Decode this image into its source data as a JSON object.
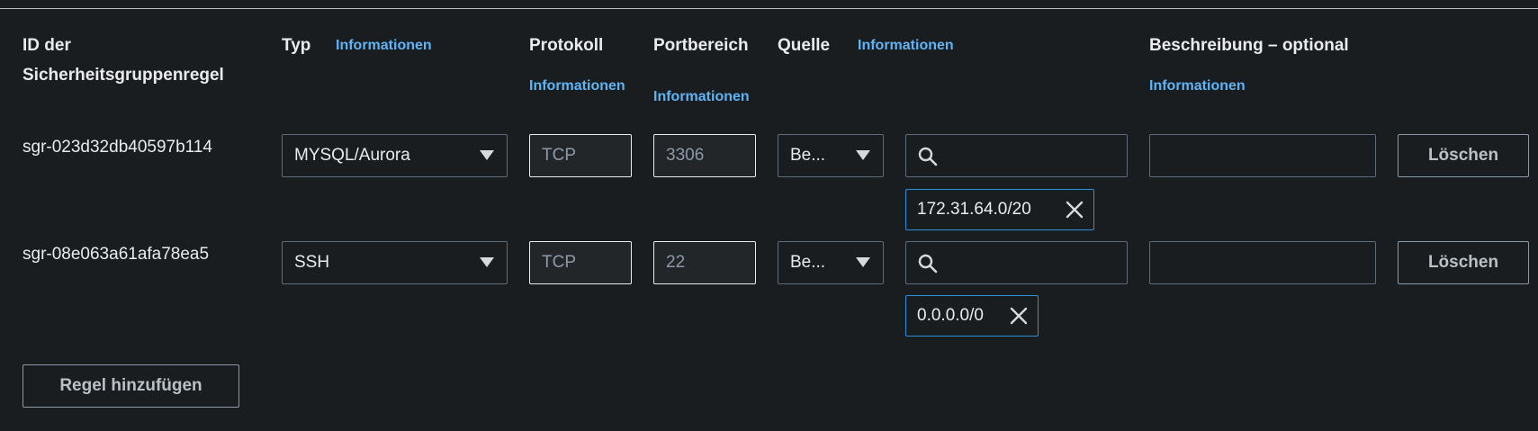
{
  "headers": {
    "rule_id": "ID der Sicherheitsgruppenregel",
    "rule_id_line1": "ID der",
    "rule_id_line2": "Sicherheitsgruppenregel",
    "type": "Typ",
    "protocol": "Protokoll",
    "port_range": "Portbereich",
    "source": "Quelle",
    "description": "Beschreibung – optional",
    "info_link": "Informationen"
  },
  "rules": [
    {
      "id": "sgr-023d32db40597b114",
      "type": "MYSQL/Aurora",
      "protocol": "TCP",
      "port": "3306",
      "source_select": "Be...",
      "source_search": "",
      "source_token": "172.31.64.0/20",
      "description": "",
      "delete_label": "Löschen"
    },
    {
      "id": "sgr-08e063a61afa78ea5",
      "type": "SSH",
      "protocol": "TCP",
      "port": "22",
      "source_select": "Be...",
      "source_search": "",
      "source_token": "0.0.0.0/0",
      "description": "",
      "delete_label": "Löschen"
    }
  ],
  "add_rule_label": "Regel hinzufügen",
  "icons": {
    "search": "search-icon",
    "remove": "close-icon",
    "dropdown": "caret-down-icon"
  },
  "colors": {
    "background": "#1a1d20",
    "link": "#5fb4f5",
    "token_border": "#2f8fd9"
  }
}
